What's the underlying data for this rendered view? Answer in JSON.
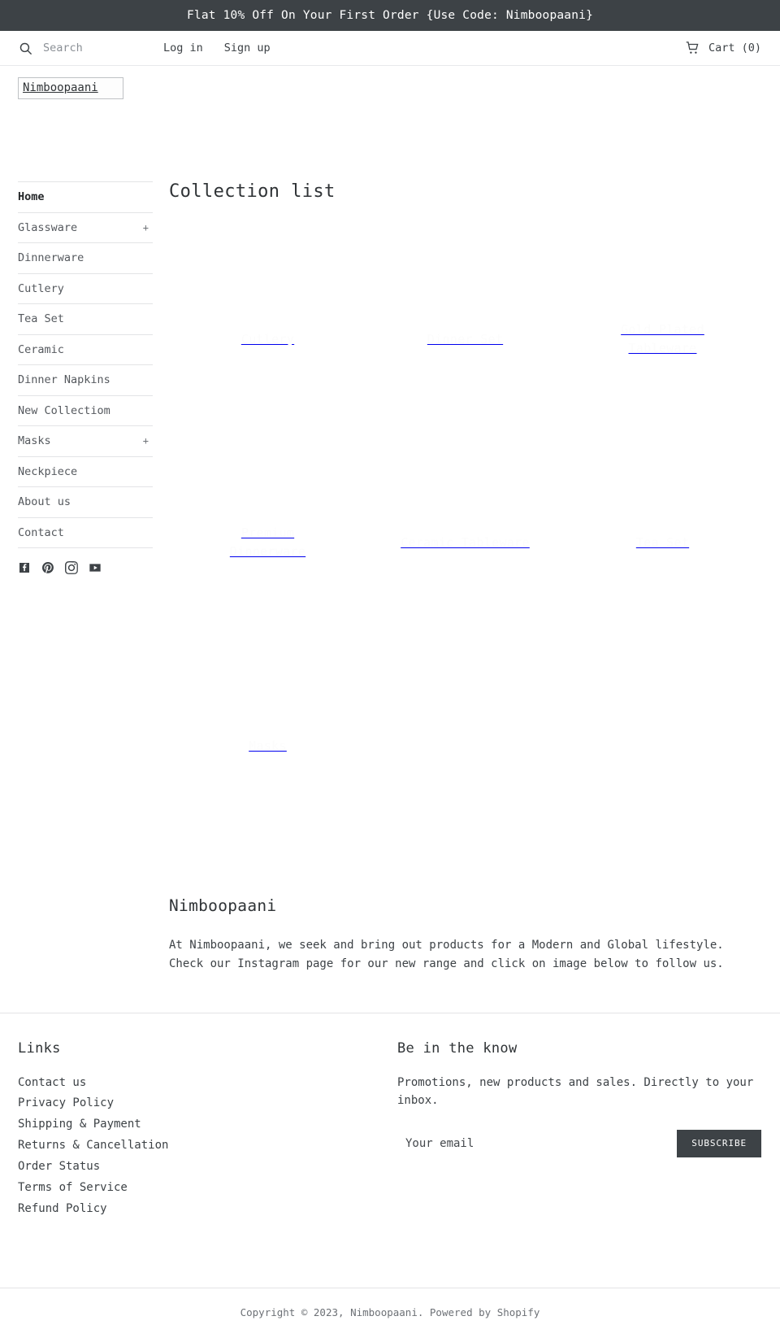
{
  "announcement": {
    "text": "Flat 10% Off On Your First Order {Use Code: Nimboopaani}",
    "background": "#3d4246",
    "color": "#ffffff"
  },
  "topbar": {
    "search_icon": "search-icon",
    "search_placeholder": "Search",
    "search_value": "",
    "login_label": "Log in",
    "signup_label": "Sign up",
    "cart_icon": "shopping-cart-icon",
    "cart_label": "Cart (0)"
  },
  "logo": {
    "alt_text": "Nimboopaani"
  },
  "sidebar": {
    "items": [
      {
        "label": "Home",
        "active": true,
        "expandable": false,
        "expand_symbol": ""
      },
      {
        "label": "Glassware",
        "active": false,
        "expandable": true,
        "expand_symbol": "+"
      },
      {
        "label": "Dinnerware",
        "active": false,
        "expandable": false,
        "expand_symbol": ""
      },
      {
        "label": "Cutlery",
        "active": false,
        "expandable": false,
        "expand_symbol": ""
      },
      {
        "label": "Tea Set",
        "active": false,
        "expandable": false,
        "expand_symbol": ""
      },
      {
        "label": "Ceramic",
        "active": false,
        "expandable": false,
        "expand_symbol": ""
      },
      {
        "label": "Dinner Napkins",
        "active": false,
        "expandable": false,
        "expand_symbol": ""
      },
      {
        "label": "New Collectiom",
        "active": false,
        "expandable": false,
        "expand_symbol": ""
      },
      {
        "label": "Masks",
        "active": false,
        "expandable": true,
        "expand_symbol": "+"
      },
      {
        "label": "Neckpiece",
        "active": false,
        "expandable": false,
        "expand_symbol": ""
      },
      {
        "label": "About us",
        "active": false,
        "expandable": false,
        "expand_symbol": ""
      },
      {
        "label": "Contact",
        "active": false,
        "expandable": false,
        "expand_symbol": ""
      }
    ],
    "social": [
      {
        "name": "facebook-icon",
        "label": "Facebook"
      },
      {
        "name": "pinterest-icon",
        "label": "Pinterest"
      },
      {
        "name": "instagram-icon",
        "label": "Instagram"
      },
      {
        "name": "youtube-icon",
        "label": "YouTube"
      }
    ]
  },
  "main": {
    "page_title": "Collection list",
    "collections": [
      {
        "title": "Cutlery"
      },
      {
        "title": "Dinner Set"
      },
      {
        "title": "Gold Plated Tableware"
      },
      {
        "title": "Premium Dinnerware"
      },
      {
        "title": "Ceramic Tableware"
      },
      {
        "title": "Tea Set"
      },
      {
        "title": "Masks"
      }
    ]
  },
  "about": {
    "title": "Nimboopaani",
    "text": "At Nimboopaani, we seek and bring out products for a Modern and Global lifestyle. Check our Instagram page for our new range and click on image below to follow us."
  },
  "footer": {
    "links_heading": "Links",
    "links": [
      "Contact us",
      "Privacy Policy",
      "Shipping & Payment",
      "Returns & Cancellation",
      "Order Status",
      "Terms of Service",
      "Refund Policy"
    ],
    "newsletter_heading": "Be in the know",
    "newsletter_text": "Promotions, new products and sales. Directly to your inbox.",
    "email_placeholder": "Your email",
    "email_value": "",
    "subscribe_label": "SUBSCRIBE",
    "subscribe_background": "#3d4246",
    "copyright_prefix": "Copyright © 2023, ",
    "copyright_shop": "Nimboopaani",
    "copyright_mid": ". Powered by ",
    "copyright_platform": "Shopify"
  }
}
